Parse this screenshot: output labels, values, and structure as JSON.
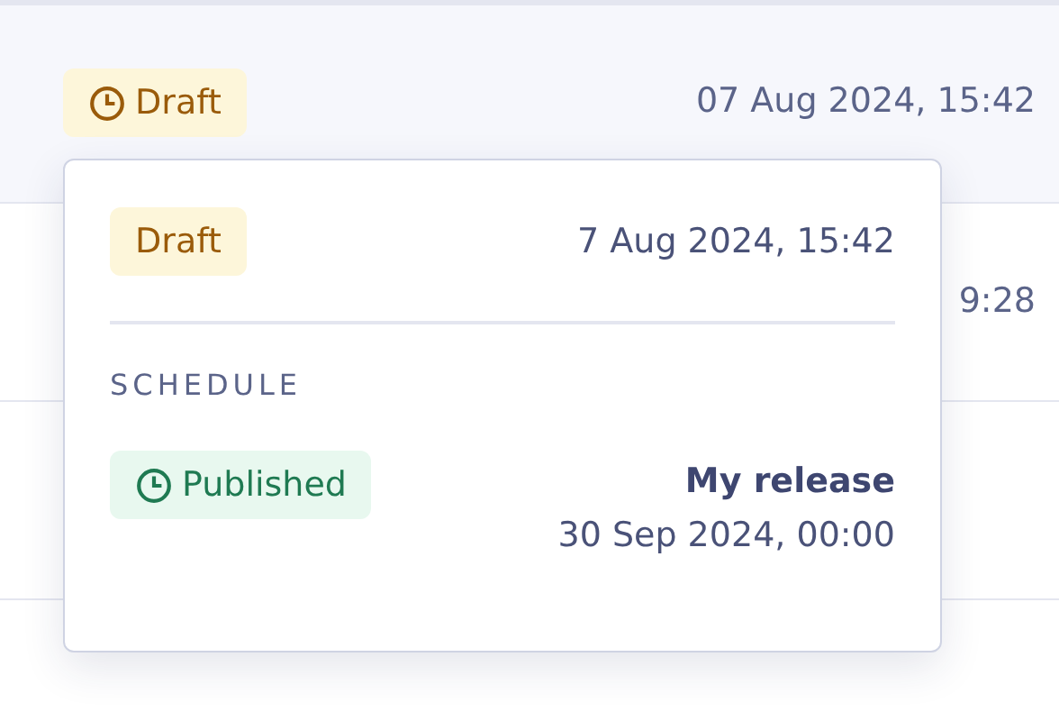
{
  "rows": [
    {
      "status": {
        "label": "Draft",
        "kind": "draft",
        "scheduled": true
      },
      "date": "07 Aug 2024, 15:42"
    },
    {
      "date": "9:28"
    }
  ],
  "popover": {
    "status": {
      "label": "Draft",
      "kind": "draft",
      "scheduled": false
    },
    "date": "7 Aug 2024, 15:42",
    "section_title": "SCHEDULE",
    "schedule": {
      "status": {
        "label": "Published",
        "kind": "published",
        "scheduled": true
      },
      "release": "My release",
      "date": "30 Sep 2024, 00:00"
    }
  }
}
